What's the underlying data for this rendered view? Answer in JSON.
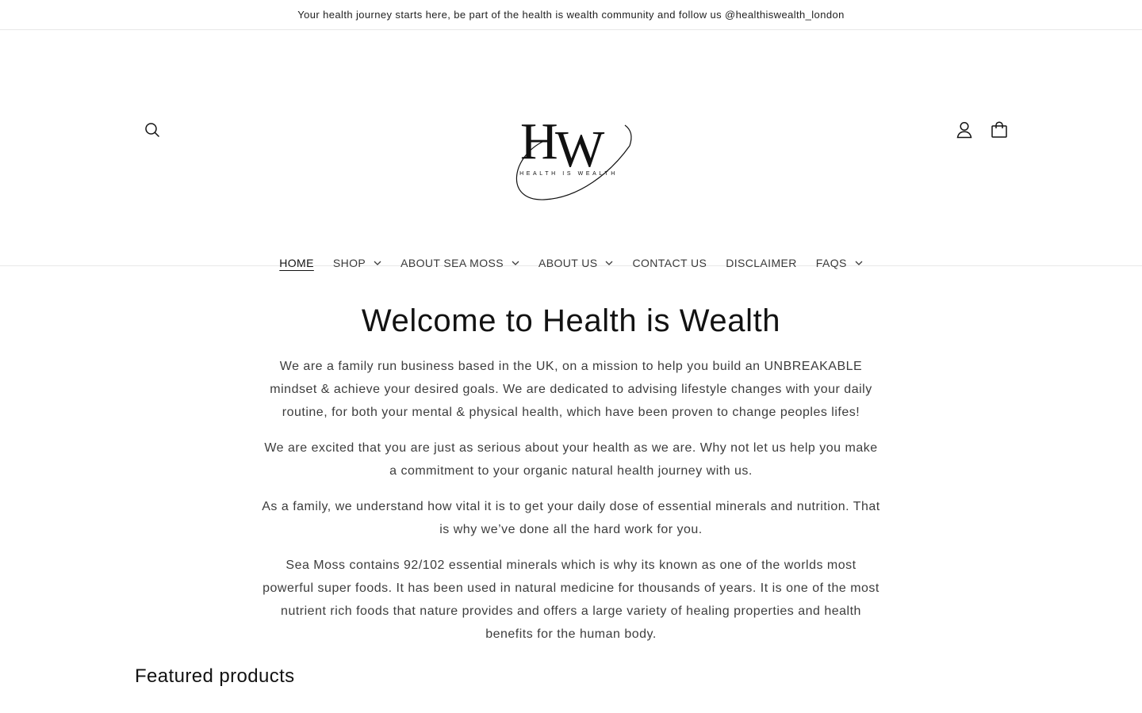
{
  "announcement": {
    "text": "Your health journey starts here, be part of the health is wealth community and follow us @healthiswealth_london"
  },
  "header": {
    "logo_text": "HEALTH IS WEALTH",
    "icons": {
      "search": "search-icon",
      "account": "account-icon",
      "cart": "cart-icon"
    }
  },
  "nav": {
    "items": [
      {
        "label": "HOME",
        "active": true,
        "has_dropdown": false
      },
      {
        "label": "SHOP",
        "active": false,
        "has_dropdown": true
      },
      {
        "label": "ABOUT SEA MOSS",
        "active": false,
        "has_dropdown": true
      },
      {
        "label": "ABOUT US",
        "active": false,
        "has_dropdown": true
      },
      {
        "label": "CONTACT US",
        "active": false,
        "has_dropdown": false
      },
      {
        "label": "DISCLAIMER",
        "active": false,
        "has_dropdown": false
      },
      {
        "label": "FAQS",
        "active": false,
        "has_dropdown": true
      }
    ]
  },
  "main": {
    "title": "Welcome to Health is Wealth",
    "paragraphs": [
      "We are a family run business based in the UK, on a mission to help you build an UNBREAKABLE mindset & achieve your desired goals. We are dedicated to advising lifestyle changes with your daily routine, for both your mental & physical health, which have been proven to change peoples lifes!",
      "We are excited that you are just as serious about your health as we are. Why not let us help you make a commitment to your organic natural health journey with us.",
      "As a family, we understand how vital it is to get your daily dose of essential minerals and nutrition. That is why we’ve done all the hard work for you.",
      "Sea Moss contains 92/102 essential minerals which is why its known as one of the worlds most powerful super foods. It has been used in natural medicine for thousands of years. It is one of the most nutrient rich foods that nature provides and offers a large variety of healing properties and health benefits for the human body."
    ]
  },
  "featured": {
    "heading": "Featured products"
  },
  "colors": {
    "text": "#121212",
    "body_text": "#3d3d3d",
    "border": "#e8e8e8",
    "background": "#ffffff"
  }
}
